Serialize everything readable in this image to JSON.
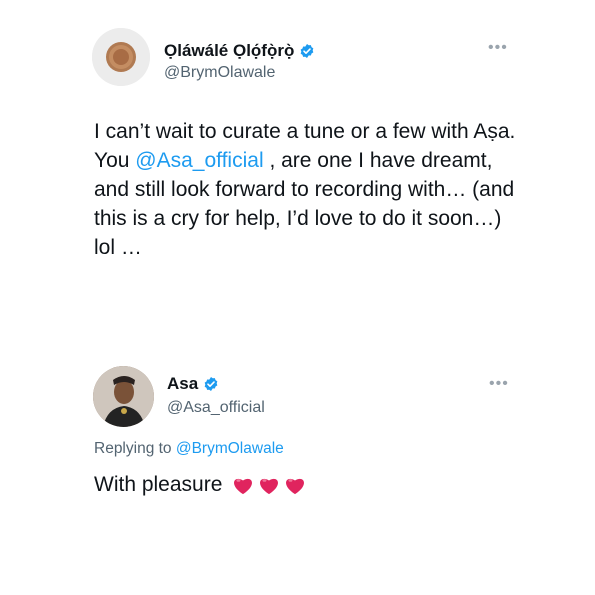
{
  "tweet": {
    "author_name": "Ọláwálé Ọlọ́fọ̀rọ̀",
    "author_handle": "@BrymOlawale",
    "text_part1": "I can’t wait to curate a tune or a few with Aṣa. You ",
    "text_mention": "@Asa_official",
    "text_part2": " , are one I have dreamt, and still look forward to recording with… (and this is a cry for help, I’d love to do it soon…) lol …"
  },
  "reply": {
    "author_name": "Asa",
    "author_handle": "@Asa_official",
    "replying_to_label": "Replying to ",
    "replying_to_handle": "@BrymOlawale",
    "text": "With pleasure",
    "emoji_icons": [
      "heart-icon",
      "heart-icon",
      "heart-icon"
    ]
  },
  "colors": {
    "link": "#1d9bf0",
    "secondary_text": "#536471",
    "verified": "#1d9bf0",
    "heart": "#e0245e"
  }
}
